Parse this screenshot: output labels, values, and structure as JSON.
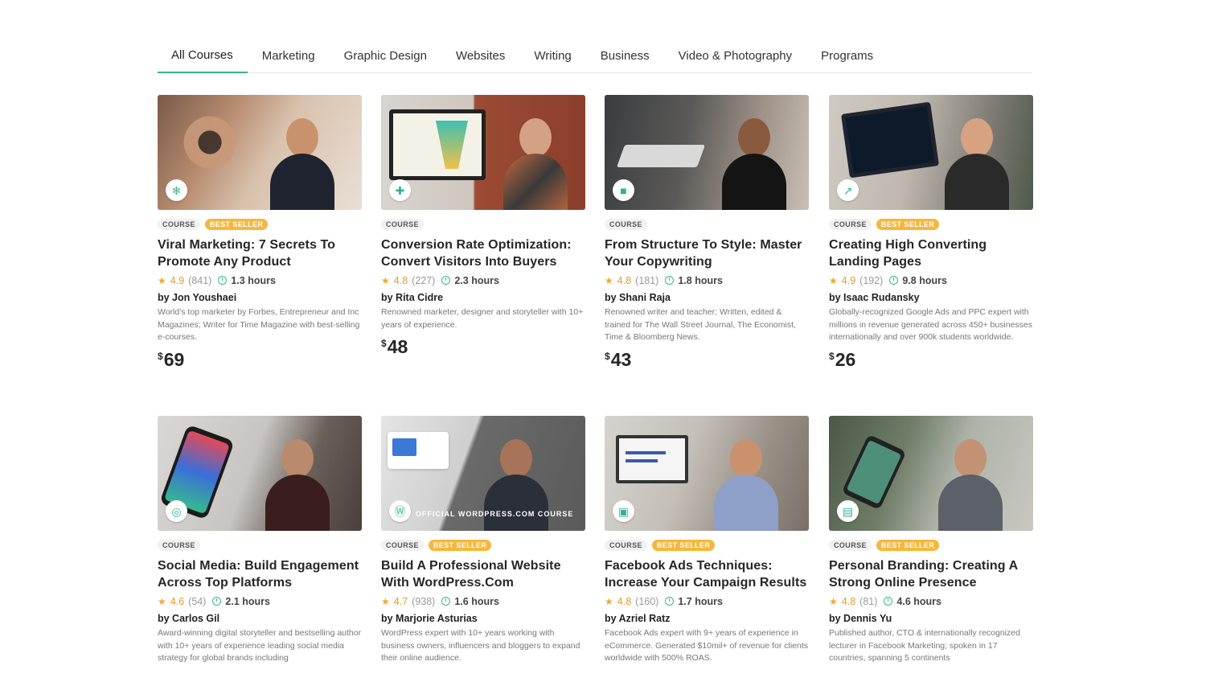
{
  "tabs": [
    {
      "label": "All Courses",
      "active": true
    },
    {
      "label": "Marketing",
      "active": false
    },
    {
      "label": "Graphic Design",
      "active": false
    },
    {
      "label": "Websites",
      "active": false
    },
    {
      "label": "Writing",
      "active": false
    },
    {
      "label": "Business",
      "active": false
    },
    {
      "label": "Video & Photography",
      "active": false
    },
    {
      "label": "Programs",
      "active": false
    }
  ],
  "colors": {
    "accent": "#37b88f",
    "best_seller": "#f6b73c",
    "star": "#f4a62a"
  },
  "courses": [
    {
      "tag": "COURSE",
      "best_seller": "BEST SELLER",
      "title": "Viral Marketing: 7 Secrets To Promote Any Product",
      "rating": "4.9",
      "count": "(841)",
      "hours": "1.3 hours",
      "author": "by Jon Youshaei",
      "desc": "World's top marketer by Forbes, Entrepreneur and Inc Magazines; Writer for Time Magazine with best-selling e-courses.",
      "currency": "$",
      "price": "69",
      "icon": "snowflake-icon"
    },
    {
      "tag": "COURSE",
      "best_seller": "",
      "title": "Conversion Rate Optimization: Convert Visitors Into Buyers",
      "rating": "4.8",
      "count": "(227)",
      "hours": "2.3 hours",
      "author": "by Rita Cidre",
      "desc": "Renowned marketer, designer and storyteller with 10+ years of experience.",
      "currency": "$",
      "price": "48",
      "icon": "growth-icon"
    },
    {
      "tag": "COURSE",
      "best_seller": "",
      "title": "From Structure To Style: Master Your Copywriting",
      "rating": "4.8",
      "count": "(181)",
      "hours": "1.8 hours",
      "author": "by Shani Raja",
      "desc": "Renowned writer and teacher; Written, edited & trained for The Wall Street Journal, The Economist, Time & Bloomberg News.",
      "currency": "$",
      "price": "43",
      "icon": "document-icon"
    },
    {
      "tag": "COURSE",
      "best_seller": "BEST SELLER",
      "title": "Creating High Converting Landing Pages",
      "rating": "4.9",
      "count": "(192)",
      "hours": "9.8 hours",
      "author": "by Isaac Rudansky",
      "desc": "Globally-recognized Google Ads and PPC expert with millions in revenue generated across 450+ businesses internationally and over 900k students worldwide.",
      "currency": "$",
      "price": "26",
      "icon": "external-link-icon"
    },
    {
      "tag": "COURSE",
      "best_seller": "",
      "title": "Social Media: Build Engagement Across Top Platforms",
      "rating": "4.6",
      "count": "(54)",
      "hours": "2.1 hours",
      "author": "by Carlos Gil",
      "desc": "Award-winning digital storyteller and bestselling author with 10+ years of experience leading social media strategy for global brands including",
      "currency": "",
      "price": "",
      "icon": "social-icon"
    },
    {
      "tag": "COURSE",
      "best_seller": "BEST SELLER",
      "title": "Build A Professional Website With WordPress.Com",
      "rating": "4.7",
      "count": "(938)",
      "hours": "1.6 hours",
      "author": "by Marjorie Asturias",
      "desc": "WordPress expert with 10+ years working with business owners, influencers and bloggers to expand their online audience.",
      "currency": "",
      "price": "",
      "icon": "wordpress-icon",
      "overlay": "OFFICIAL WORDPRESS.COM COURSE"
    },
    {
      "tag": "COURSE",
      "best_seller": "BEST SELLER",
      "title": "Facebook Ads Techniques: Increase Your Campaign Results",
      "rating": "4.8",
      "count": "(160)",
      "hours": "1.7 hours",
      "author": "by Azriel Ratz",
      "desc": "Facebook Ads expert with 9+ years of experience in eCommerce. Generated $10mil+ of revenue for clients worldwide with 500% ROAS.",
      "currency": "",
      "price": "",
      "icon": "ads-icon"
    },
    {
      "tag": "COURSE",
      "best_seller": "BEST SELLER",
      "title": "Personal Branding: Creating A Strong Online Presence",
      "rating": "4.8",
      "count": "(81)",
      "hours": "4.6 hours",
      "author": "by Dennis Yu",
      "desc": "Published author, CTO & internationally recognized lecturer in Facebook Marketing; spoken in 17 countries, spanning 5 continents",
      "currency": "",
      "price": "",
      "icon": "id-card-icon"
    }
  ]
}
